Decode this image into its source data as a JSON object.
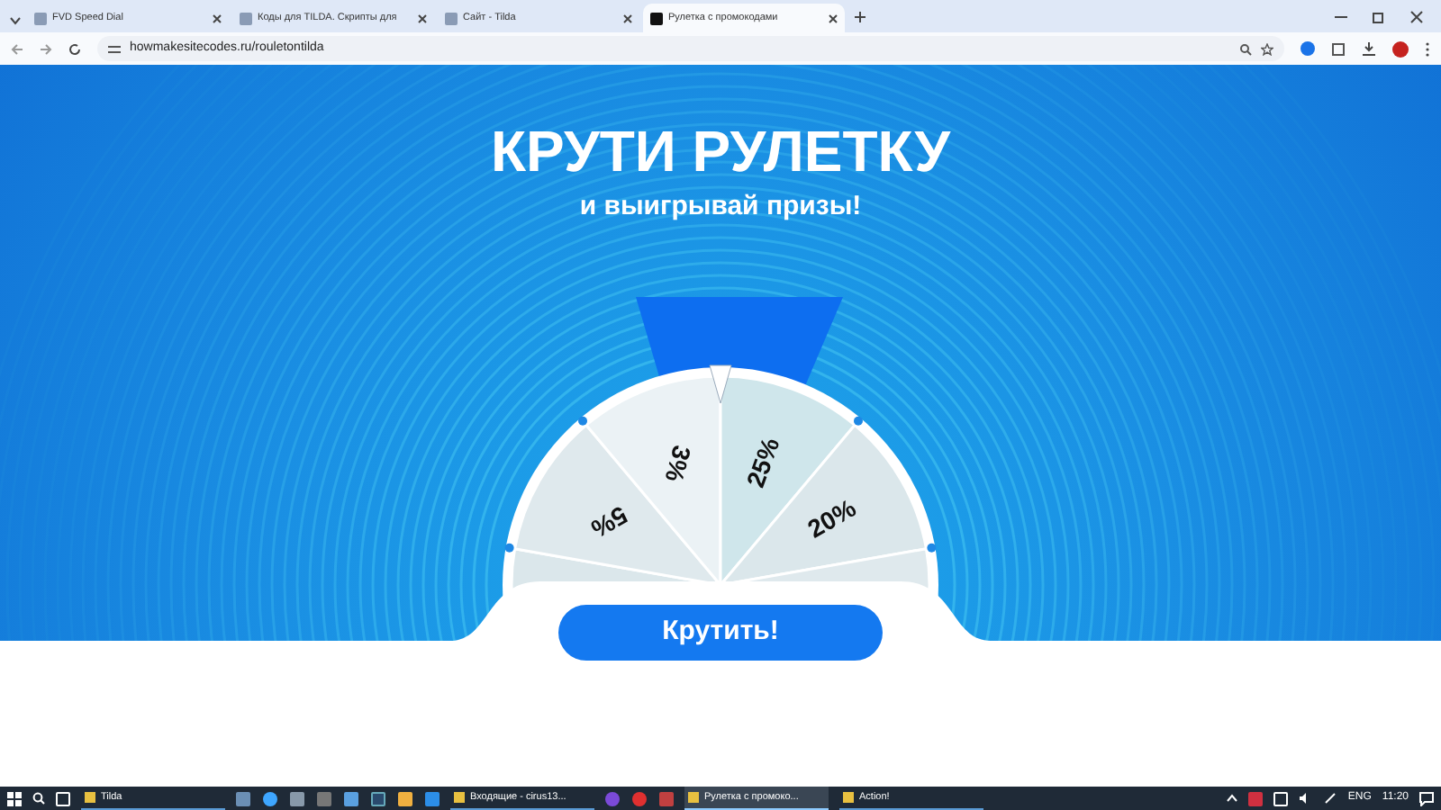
{
  "browser": {
    "tabs": [
      {
        "title": "FVD Speed Dial",
        "selected": false
      },
      {
        "title": "Коды для TILDA. Скрипты для",
        "selected": false
      },
      {
        "title": "Сайт - Tilda",
        "selected": false
      },
      {
        "title": "Рулетка с промокодами",
        "selected": true
      }
    ],
    "address": "howmakesitecodes.ru/rouletontilda"
  },
  "hero": {
    "title": "КРУТИ РУЛЕТКУ",
    "subtitle": "и выигрывай призы!"
  },
  "wheel": {
    "segments": [
      {
        "label": "5%"
      },
      {
        "label": "3%"
      },
      {
        "label": "25%"
      },
      {
        "label": "20%"
      }
    ]
  },
  "spin_button": {
    "label": "Крутить!"
  },
  "taskbar": {
    "apps": [
      {
        "label": "Tilda",
        "selected": false
      },
      {
        "label": "Входящие - cirus13...",
        "selected": false
      },
      {
        "label": "Рулетка с промоко...",
        "selected": true
      },
      {
        "label": "Action!",
        "selected": false
      }
    ],
    "language": "ENG",
    "time": "11:20"
  }
}
